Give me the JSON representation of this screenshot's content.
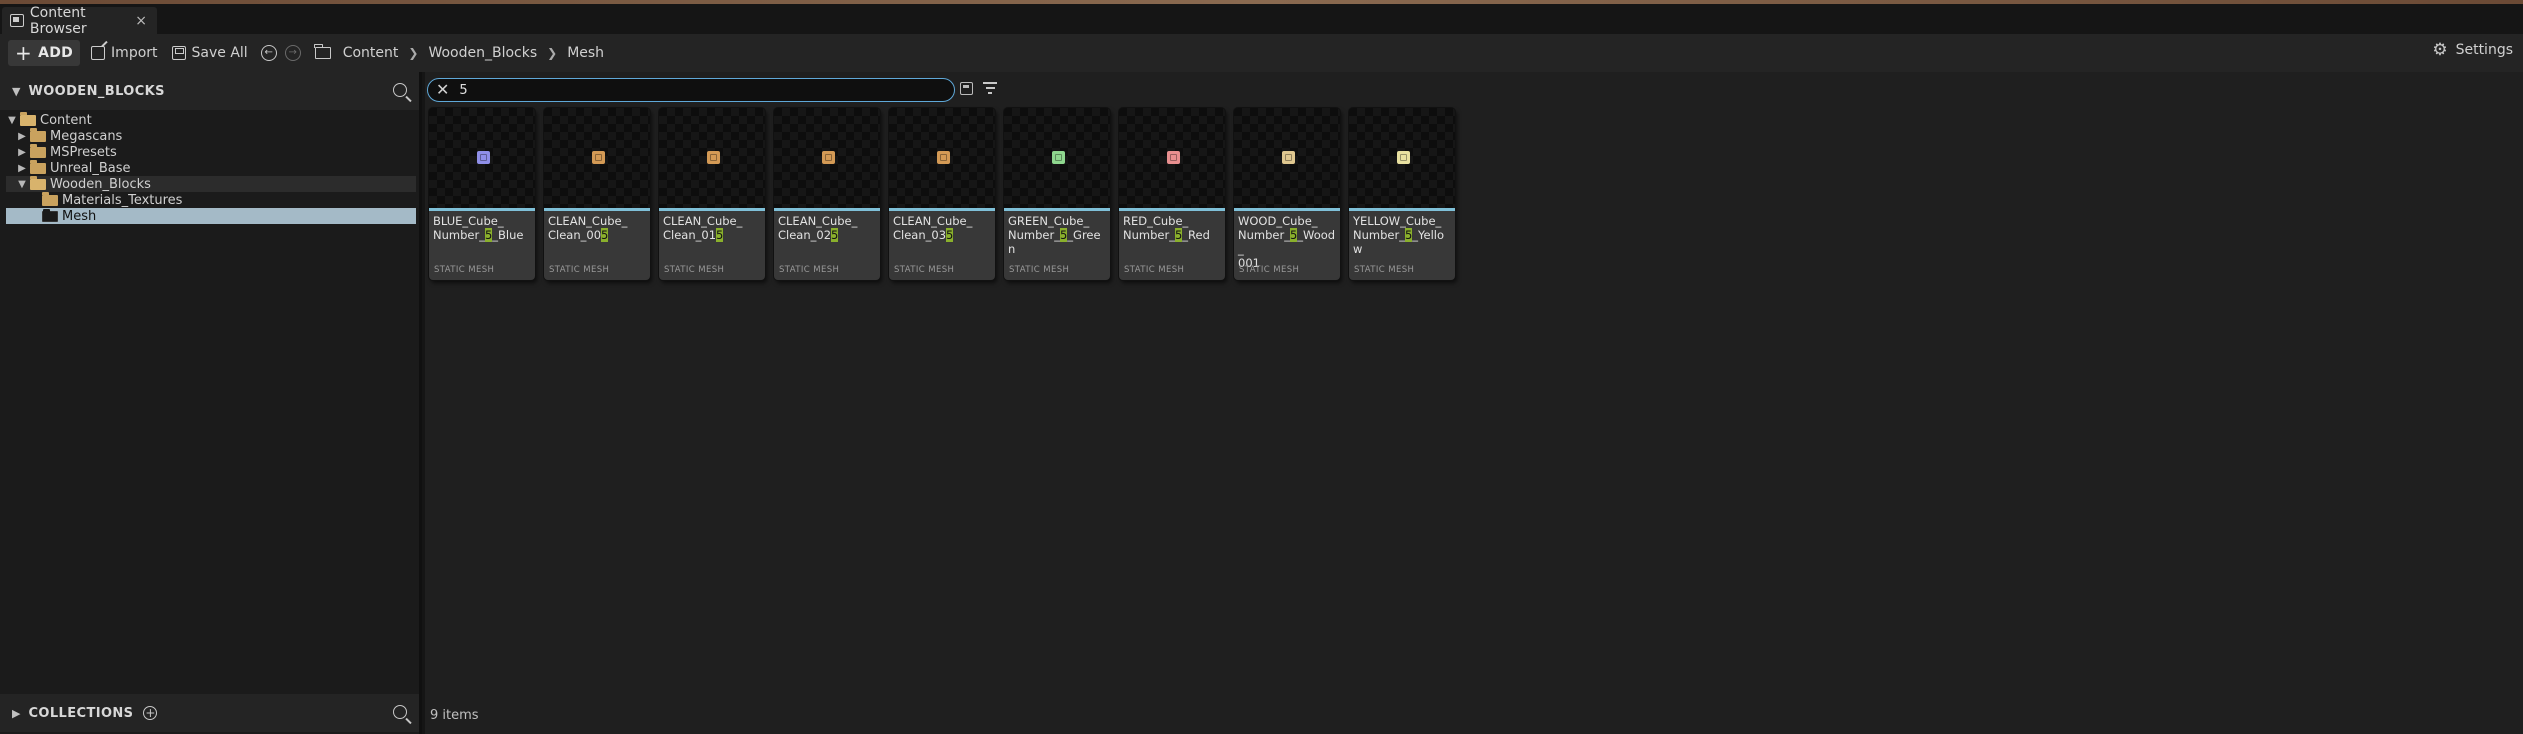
{
  "window": {
    "tab_title": "Content Browser",
    "tab_close": "×"
  },
  "toolbar": {
    "add_label": "ADD",
    "import_label": "Import",
    "save_all_label": "Save All",
    "settings_label": "Settings",
    "breadcrumb": [
      "Content",
      "Wooden_Blocks",
      "Mesh"
    ]
  },
  "sources": {
    "title": "WOODEN_BLOCKS",
    "collections_label": "COLLECTIONS",
    "tree": [
      {
        "label": "Content",
        "depth": 0,
        "expanded": true
      },
      {
        "label": "Megascans",
        "depth": 1,
        "expanded": false
      },
      {
        "label": "MSPresets",
        "depth": 1,
        "expanded": false
      },
      {
        "label": "Unreal_Base",
        "depth": 1,
        "expanded": false
      },
      {
        "label": "Wooden_Blocks",
        "depth": 1,
        "expanded": true
      },
      {
        "label": "Materials_Textures",
        "depth": 2
      },
      {
        "label": "Mesh",
        "depth": 2,
        "selected": true
      }
    ]
  },
  "search": {
    "query": "5"
  },
  "assets": [
    {
      "line1": "BLUE_Cube_",
      "line2_pre": "Number_",
      "line2_hl": "5",
      "line2_post": "_Blue",
      "line3": "",
      "type": "STATIC MESH",
      "color": "#8f8fe8"
    },
    {
      "line1": "CLEAN_Cube_",
      "line2_pre": "Clean_00",
      "line2_hl": "5",
      "line2_post": "",
      "line3": "",
      "type": "STATIC MESH",
      "color": "#d49a55"
    },
    {
      "line1": "CLEAN_Cube_",
      "line2_pre": "Clean_01",
      "line2_hl": "5",
      "line2_post": "",
      "line3": "",
      "type": "STATIC MESH",
      "color": "#d49a55"
    },
    {
      "line1": "CLEAN_Cube_",
      "line2_pre": "Clean_02",
      "line2_hl": "5",
      "line2_post": "",
      "line3": "",
      "type": "STATIC MESH",
      "color": "#d49a55"
    },
    {
      "line1": "CLEAN_Cube_",
      "line2_pre": "Clean_03",
      "line2_hl": "5",
      "line2_post": "",
      "line3": "",
      "type": "STATIC MESH",
      "color": "#d49a55"
    },
    {
      "line1": "GREEN_Cube_",
      "line2_pre": "Number_",
      "line2_hl": "5",
      "line2_post": "_Green",
      "line3": "",
      "type": "STATIC MESH",
      "color": "#8fd88f"
    },
    {
      "line1": "RED_Cube_",
      "line2_pre": "Number_",
      "line2_hl": "5",
      "line2_post": "_Red",
      "line3": "",
      "type": "STATIC MESH",
      "color": "#e88f8f"
    },
    {
      "line1": "WOOD_Cube_",
      "line2_pre": "Number_",
      "line2_hl": "5",
      "line2_post": "_Wood_",
      "line3": "001",
      "type": "STATIC MESH",
      "color": "#e0c890"
    },
    {
      "line1": "YELLOW_Cube_",
      "line2_pre": "Number_",
      "line2_hl": "5",
      "line2_post": "_Yellow",
      "line3": "",
      "type": "STATIC MESH",
      "color": "#e8e0a0"
    }
  ],
  "status": {
    "item_count": "9 items"
  }
}
